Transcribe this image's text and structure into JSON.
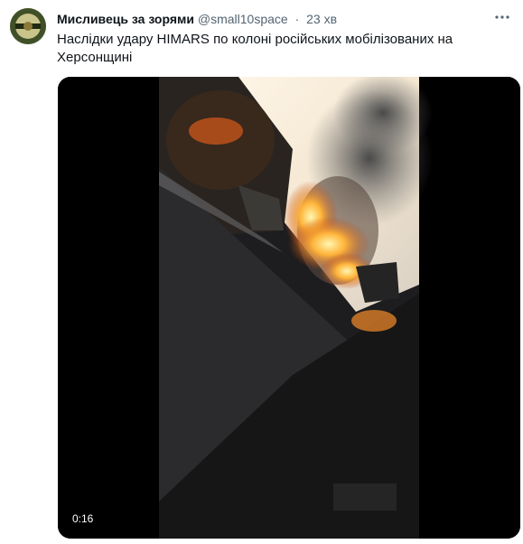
{
  "tweet": {
    "author_name": "Мисливець за зорями",
    "handle": "@small10space",
    "separator": "·",
    "time": "23 хв",
    "text_line1": "Наслідки удару HIMARS по колоні російських мобілізованих на",
    "text_line2": "Херсонщині"
  },
  "media": {
    "duration": "0:16"
  },
  "icons": {
    "avatar": "avatar-image",
    "more": "more-options-icon"
  },
  "colors": {
    "secondary_text": "#536471",
    "primary_text": "#0f1419",
    "fire": "#f28a1c",
    "smoke": "#5d5d5d"
  }
}
